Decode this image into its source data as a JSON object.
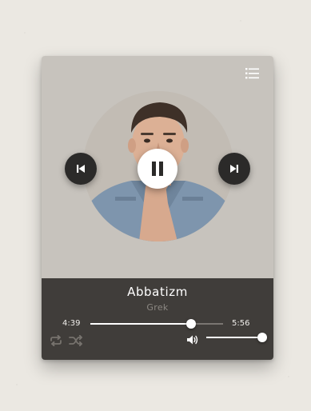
{
  "track": {
    "title": "Abbatizm",
    "artist": "Grek"
  },
  "playback": {
    "elapsed": "4:39",
    "total": "5:56",
    "progress_fraction": 0.76,
    "state": "playing"
  },
  "volume": {
    "level_fraction": 1.0
  },
  "icons": {
    "playlist": "playlist-icon",
    "previous": "skip-previous-icon",
    "pause": "pause-icon",
    "next": "skip-next-icon",
    "repeat": "repeat-icon",
    "shuffle": "shuffle-icon",
    "volume": "volume-icon"
  },
  "colors": {
    "art_background": "#c7c3bd",
    "panel_background": "#403d3a",
    "control_dark": "#2b2a29",
    "accent": "#ffffff",
    "muted_text": "#8c8883"
  }
}
